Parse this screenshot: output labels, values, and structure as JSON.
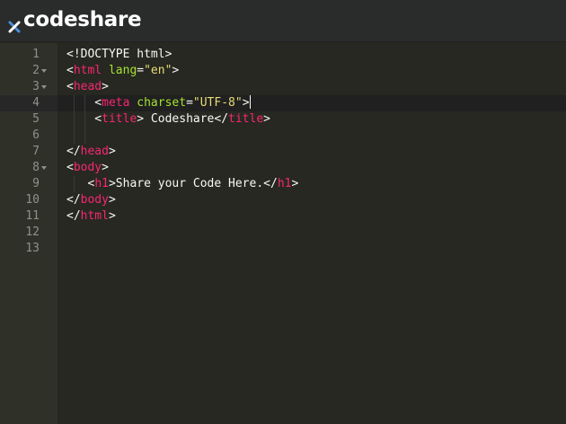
{
  "app": {
    "brand": "codeshare",
    "logo_icon": "x-icon"
  },
  "editor": {
    "active_line": 4,
    "line_numbers": [
      "1",
      "2",
      "3",
      "4",
      "5",
      "6",
      "7",
      "8",
      "9",
      "10",
      "11",
      "12",
      "13"
    ],
    "foldable_lines": [
      2,
      3,
      8
    ],
    "lines": [
      [
        {
          "t": "plain",
          "v": "<!DOCTYPE html>"
        }
      ],
      [
        {
          "t": "plain",
          "v": "<"
        },
        {
          "t": "tag",
          "v": "html"
        },
        {
          "t": "plain",
          "v": " "
        },
        {
          "t": "attr",
          "v": "lang"
        },
        {
          "t": "plain",
          "v": "="
        },
        {
          "t": "str",
          "v": "\"en\""
        },
        {
          "t": "plain",
          "v": ">"
        }
      ],
      [
        {
          "t": "plain",
          "v": "<"
        },
        {
          "t": "tag",
          "v": "head"
        },
        {
          "t": "plain",
          "v": ">"
        }
      ],
      [
        {
          "t": "plain",
          "v": "    <"
        },
        {
          "t": "tag",
          "v": "meta"
        },
        {
          "t": "plain",
          "v": " "
        },
        {
          "t": "attr",
          "v": "charset"
        },
        {
          "t": "plain",
          "v": "="
        },
        {
          "t": "str",
          "v": "\"UTF-8\""
        },
        {
          "t": "plain",
          "v": ">"
        }
      ],
      [
        {
          "t": "plain",
          "v": "    <"
        },
        {
          "t": "tag",
          "v": "title"
        },
        {
          "t": "plain",
          "v": "> Codeshare</"
        },
        {
          "t": "tag",
          "v": "title"
        },
        {
          "t": "plain",
          "v": ">"
        }
      ],
      [
        {
          "t": "plain",
          "v": ""
        }
      ],
      [
        {
          "t": "plain",
          "v": "</"
        },
        {
          "t": "tag",
          "v": "head"
        },
        {
          "t": "plain",
          "v": ">"
        }
      ],
      [
        {
          "t": "plain",
          "v": "<"
        },
        {
          "t": "tag",
          "v": "body"
        },
        {
          "t": "plain",
          "v": ">"
        }
      ],
      [
        {
          "t": "plain",
          "v": "   <"
        },
        {
          "t": "tag",
          "v": "h1"
        },
        {
          "t": "plain",
          "v": ">Share your Code Here.</"
        },
        {
          "t": "tag",
          "v": "h1"
        },
        {
          "t": "plain",
          "v": ">"
        }
      ],
      [
        {
          "t": "plain",
          "v": "</"
        },
        {
          "t": "tag",
          "v": "body"
        },
        {
          "t": "plain",
          "v": ">"
        }
      ],
      [
        {
          "t": "plain",
          "v": "</"
        },
        {
          "t": "tag",
          "v": "html"
        },
        {
          "t": "plain",
          "v": ">"
        }
      ],
      [
        {
          "t": "plain",
          "v": ""
        }
      ],
      [
        {
          "t": "plain",
          "v": ""
        }
      ]
    ]
  },
  "colors": {
    "background": "#272822",
    "gutter": "#2f3129",
    "topbar": "#2a2b2b",
    "tag": "#f92672",
    "attribute": "#a6e22e",
    "string": "#e6db74",
    "text": "#f8f8f2",
    "line_number": "#8f908a",
    "logo_x_accent": "#4a90d9"
  }
}
